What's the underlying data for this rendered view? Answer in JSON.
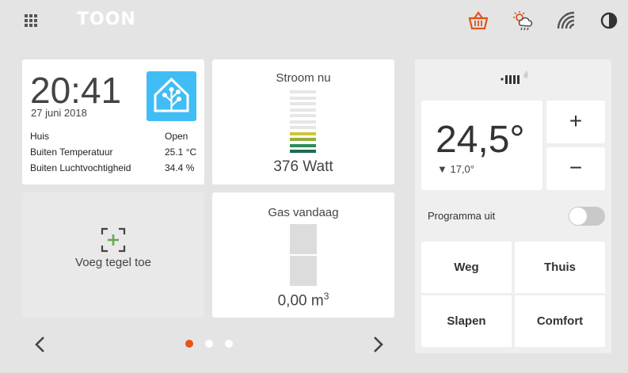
{
  "header": {
    "logo": "TOON",
    "icons": [
      "apps-grid-icon",
      "basket-icon",
      "weather-icon",
      "signal-icon",
      "contrast-icon"
    ],
    "basket_color": "#e0531a"
  },
  "clock_tile": {
    "time": "20:41",
    "date": "27 juni 2018",
    "logo_icon": "home-assistant-icon",
    "rows": [
      {
        "label": "Huis",
        "value": "Open"
      },
      {
        "label": "Buiten Temperatuur",
        "value": "25.1 °C"
      },
      {
        "label": "Buiten Luchtvochtigheid",
        "value": "34.4 %"
      }
    ]
  },
  "power_tile": {
    "title": "Stroom nu",
    "value": "376 Watt",
    "level_segments_active": 4,
    "level_segments_total": 11
  },
  "add_tile": {
    "label": "Voeg tegel toe",
    "icon": "add-tile-icon"
  },
  "gas_tile": {
    "title": "Gas vandaag",
    "value": "0,00 m",
    "unit_sup": "3"
  },
  "pager": {
    "pages": 3,
    "active": 0,
    "prev_icon": "chevron-left-icon",
    "next_icon": "chevron-right-icon"
  },
  "thermostat": {
    "status_icon": "radiator-flame-icon",
    "current_temp": "24,5°",
    "setpoint": "▼ 17,0°",
    "plus_label": "+",
    "minus_label": "−",
    "program_label": "Programma uit",
    "program_on": false,
    "presets": [
      "Weg",
      "Thuis",
      "Slapen",
      "Comfort"
    ]
  },
  "colors": {
    "background": "#e4e4e4",
    "accent": "#e9531a",
    "ha_blue": "#41bdf5",
    "bar_green": "#2e7d4f"
  }
}
